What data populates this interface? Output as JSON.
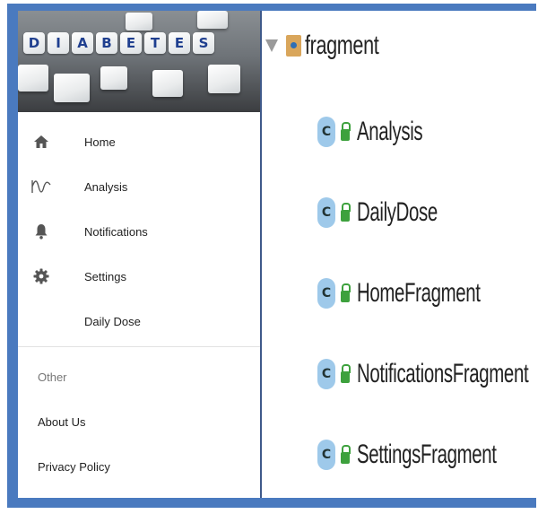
{
  "drawer": {
    "banner_letters": [
      "D",
      "I",
      "A",
      "B",
      "E",
      "T",
      "E",
      "S"
    ],
    "items": [
      {
        "label": "Home",
        "icon": "home-icon"
      },
      {
        "label": "Analysis",
        "icon": "analysis-wave-icon"
      },
      {
        "label": "Notifications",
        "icon": "bell-icon"
      },
      {
        "label": "Settings",
        "icon": "gear-icon"
      },
      {
        "label": "Daily Dose",
        "icon": ""
      }
    ],
    "section_title": "Other",
    "extra_items": [
      {
        "label": "About Us"
      },
      {
        "label": "Privacy Policy"
      }
    ]
  },
  "tree": {
    "root_label": "fragment",
    "classes": [
      {
        "label": "Analysis"
      },
      {
        "label": "DailyDose"
      },
      {
        "label": "HomeFragment"
      },
      {
        "label": "NotificationsFragment"
      },
      {
        "label": "SettingsFragment"
      }
    ]
  },
  "colors": {
    "frame": "#4a7abf",
    "class_badge": "#9ec9ea",
    "lock": "#3da13d",
    "folder": "#d9a65b"
  }
}
